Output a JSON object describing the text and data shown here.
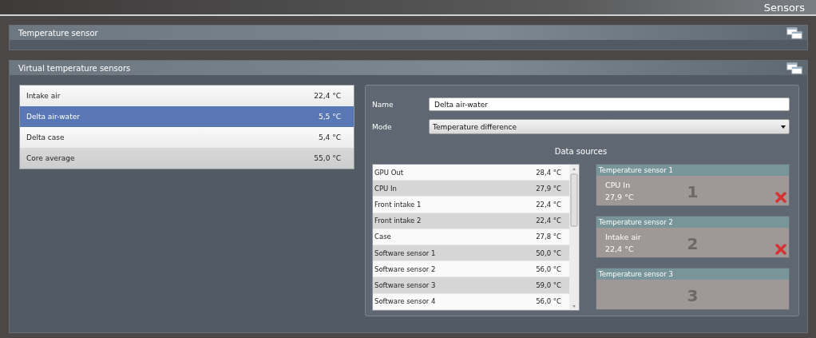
{
  "header": {
    "title": "Sensors"
  },
  "panels": [
    {
      "title": "Temperature sensor"
    },
    {
      "title": "Virtual temperature sensors"
    }
  ],
  "virtual_sensors": [
    {
      "name": "Intake air",
      "value": "22,4 °C",
      "selected": false
    },
    {
      "name": "Delta air-water",
      "value": "5,5 °C",
      "selected": true
    },
    {
      "name": "Delta case",
      "value": "5,4 °C",
      "selected": false
    },
    {
      "name": "Core average",
      "value": "55,0 °C",
      "selected": false
    }
  ],
  "editor": {
    "name_label": "Name",
    "name_value": "Delta air-water",
    "mode_label": "Mode",
    "mode_value": "Temperature difference",
    "sources_title": "Data sources"
  },
  "data_sources": [
    {
      "name": "GPU Out",
      "value": "28,4 °C"
    },
    {
      "name": "CPU In",
      "value": "27,9 °C"
    },
    {
      "name": "Front intake 1",
      "value": "22,4 °C"
    },
    {
      "name": "Front intake 2",
      "value": "22,4 °C"
    },
    {
      "name": "Case",
      "value": "27,8 °C"
    },
    {
      "name": "Software sensor 1",
      "value": "50,0 °C"
    },
    {
      "name": "Software sensor 2",
      "value": "56,0 °C"
    },
    {
      "name": "Software sensor 3",
      "value": "59,0 °C"
    },
    {
      "name": "Software sensor 4",
      "value": "56,0 °C"
    }
  ],
  "slots": [
    {
      "title": "Temperature sensor 1",
      "number": "1",
      "source": "CPU In",
      "value": "27,9 °C"
    },
    {
      "title": "Temperature sensor 2",
      "number": "2",
      "source": "Intake air",
      "value": "22,4 °C"
    },
    {
      "title": "Temperature sensor 3",
      "number": "3"
    }
  ]
}
